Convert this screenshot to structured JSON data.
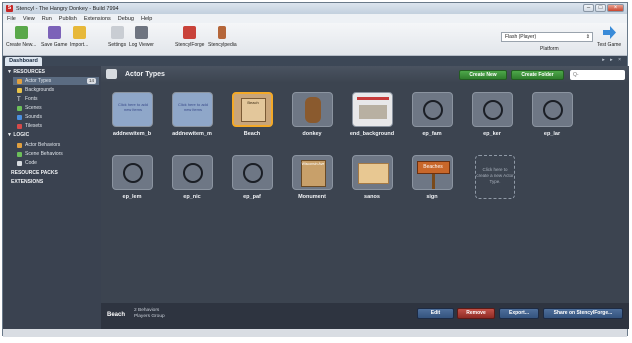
{
  "window": {
    "title": "Stencyl - The Hangry Donkey - Build 7994",
    "app_icon_letter": "S"
  },
  "menu": [
    "File",
    "View",
    "Run",
    "Publish",
    "Extensions",
    "Debug",
    "Help"
  ],
  "toolbar": {
    "create_new": "Create New...",
    "save_game": "Save Game",
    "import": "Import...",
    "settings": "Settings",
    "log_viewer": "Log Viewer",
    "stencylforge": "StencylForge",
    "stencylpedia": "Stencylpedia",
    "platform_value": "Flash (Player)",
    "platform_label": "Platform",
    "test_game": "Test Game"
  },
  "tabs": {
    "dashboard": "Dashboard"
  },
  "sidebar": {
    "resources_header": "RESOURCES",
    "resources": [
      {
        "label": "Actor Types",
        "badge": "14"
      },
      {
        "label": "Backgrounds"
      },
      {
        "label": "Fonts"
      },
      {
        "label": "Scenes"
      },
      {
        "label": "Sounds"
      },
      {
        "label": "Tilesets"
      }
    ],
    "logic_header": "LOGIC",
    "logic": [
      {
        "label": "Actor Behaviors"
      },
      {
        "label": "Scene Behaviors"
      },
      {
        "label": "Code"
      }
    ],
    "resource_packs": "RESOURCE PACKS",
    "extensions": "EXTENSIONS"
  },
  "main": {
    "title": "Actor Types",
    "create_new": "Create New",
    "create_folder": "Create Folder",
    "search_placeholder": "Q-",
    "actors": [
      {
        "label": "addnewitem_b",
        "thumb_text": "Click here to add new items"
      },
      {
        "label": "addnewitem_m",
        "thumb_text": "Click here to add new items"
      },
      {
        "label": "Beach",
        "thumb_text": "Beach"
      },
      {
        "label": "donkey"
      },
      {
        "label": "end_background"
      },
      {
        "label": "ep_fam"
      },
      {
        "label": "ep_ker"
      },
      {
        "label": "ep_lar"
      },
      {
        "label": "ep_lem"
      },
      {
        "label": "ep_nic"
      },
      {
        "label": "ep_paf"
      },
      {
        "label": "Monument",
        "thumb_text": "Wisconsin Ave"
      },
      {
        "label": "sanos"
      },
      {
        "label": "sign",
        "thumb_text": "Beaches"
      }
    ],
    "placeholder": "Click here to create a new Actor Type."
  },
  "bottom": {
    "selected_name": "Beach",
    "behaviors": "2 Behaviors",
    "group": "Players Group",
    "edit": "Edit",
    "remove": "Remove",
    "export": "Export...",
    "share": "Share on StencylForge..."
  }
}
